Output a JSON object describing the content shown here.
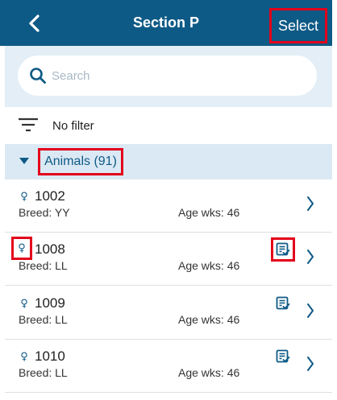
{
  "header": {
    "title": "Section P",
    "select_label": "Select"
  },
  "search": {
    "placeholder": "Search"
  },
  "filter": {
    "label": "No filter"
  },
  "group": {
    "label": "Animals (91)"
  },
  "animals": [
    {
      "sex_symbol": "♀",
      "id": "1002",
      "breed": "Breed: YY",
      "age": "Age wks: 46",
      "has_record": false
    },
    {
      "sex_symbol": "♀",
      "id": "1008",
      "breed": "Breed: LL",
      "age": "Age wks: 46",
      "has_record": true
    },
    {
      "sex_symbol": "♀",
      "id": "1009",
      "breed": "Breed: LL",
      "age": "Age wks: 46",
      "has_record": true
    },
    {
      "sex_symbol": "♀",
      "id": "1010",
      "breed": "Breed: LL",
      "age": "Age wks: 46",
      "has_record": true
    }
  ],
  "colors": {
    "header_bg": "#0e5a86",
    "accent": "#0e5a86",
    "highlight": "#e3001b",
    "search_bg": "#e3eef6",
    "group_bg": "#dbe9f4"
  },
  "icons": {
    "back": "chevron-left-icon",
    "search": "search-icon",
    "filter": "filter-icon",
    "caret": "caret-down-icon",
    "sex": "female-icon",
    "record": "record-checked-icon",
    "row_nav": "chevron-right-icon"
  }
}
